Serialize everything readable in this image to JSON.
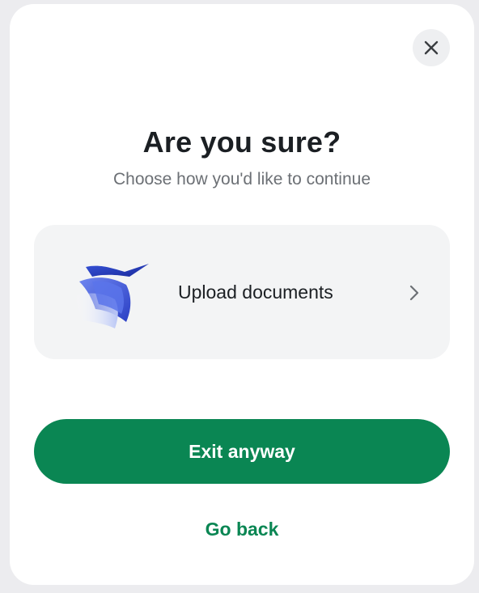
{
  "dialog": {
    "close_icon": "close-icon",
    "title": "Are you sure?",
    "subtitle": "Choose how you'd like to continue",
    "option": {
      "label": "Upload documents",
      "illustration_icon": "documents-illustration-icon",
      "chevron_icon": "chevron-right-icon"
    },
    "primary_button_label": "Exit anyway",
    "secondary_link_label": "Go back"
  },
  "colors": {
    "accent": "#0a8653",
    "title": "#1b1f23",
    "subtitle": "#6c7075",
    "card_background": "#f3f4f5",
    "close_background": "#eeeff1"
  }
}
